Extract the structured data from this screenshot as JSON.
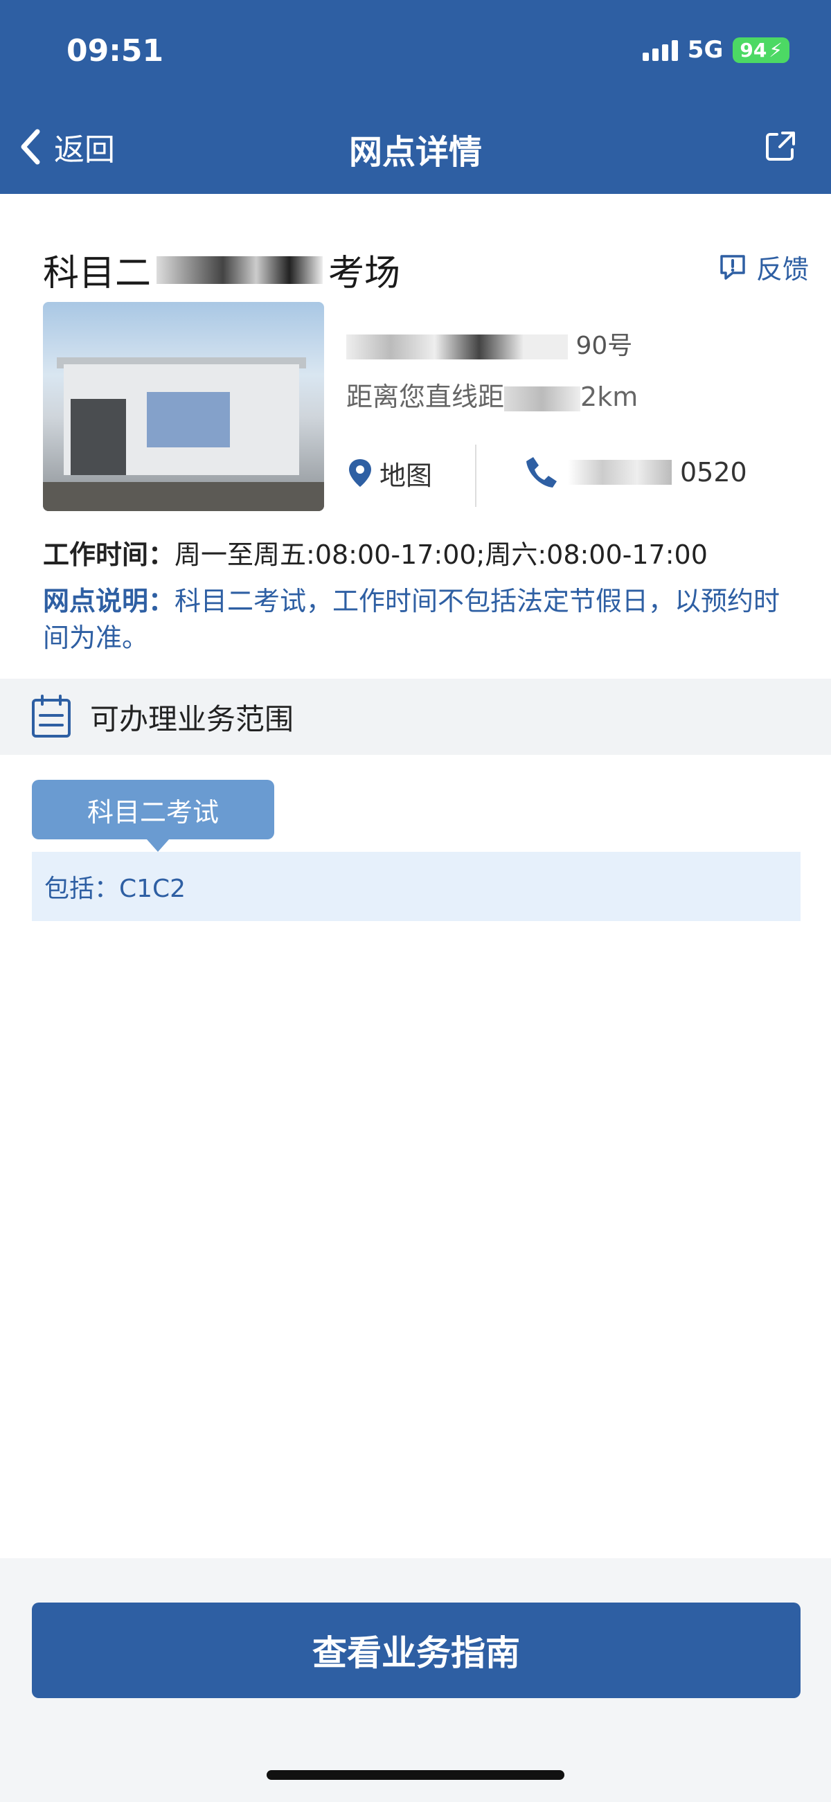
{
  "status_bar": {
    "time": "09:51",
    "network": "5G",
    "battery": "94"
  },
  "nav": {
    "back_label": "返回",
    "title": "网点详情"
  },
  "site": {
    "name_prefix": "科目二",
    "name_suffix": "考场",
    "feedback_label": "反馈",
    "address_visible": "90号",
    "distance_prefix": "距离您直线距",
    "distance_suffix": "2km",
    "map_label": "地图",
    "phone_visible": "0520",
    "hours_label": "工作时间：",
    "hours_value": "周一至周五:08:00-17:00;周六:08:00-17:00",
    "desc_label": "网点说明：",
    "desc_value": "科目二考试，工作时间不包括法定节假日，以预约时间为准。"
  },
  "business": {
    "section_title": "可办理业务范围",
    "tag": "科目二考试",
    "includes": "包括：C1C2"
  },
  "footer": {
    "guide_button": "查看业务指南"
  },
  "colors": {
    "primary": "#2e5fa3",
    "tag": "#6a9bd1",
    "includes_bg": "#e6f0fb"
  }
}
